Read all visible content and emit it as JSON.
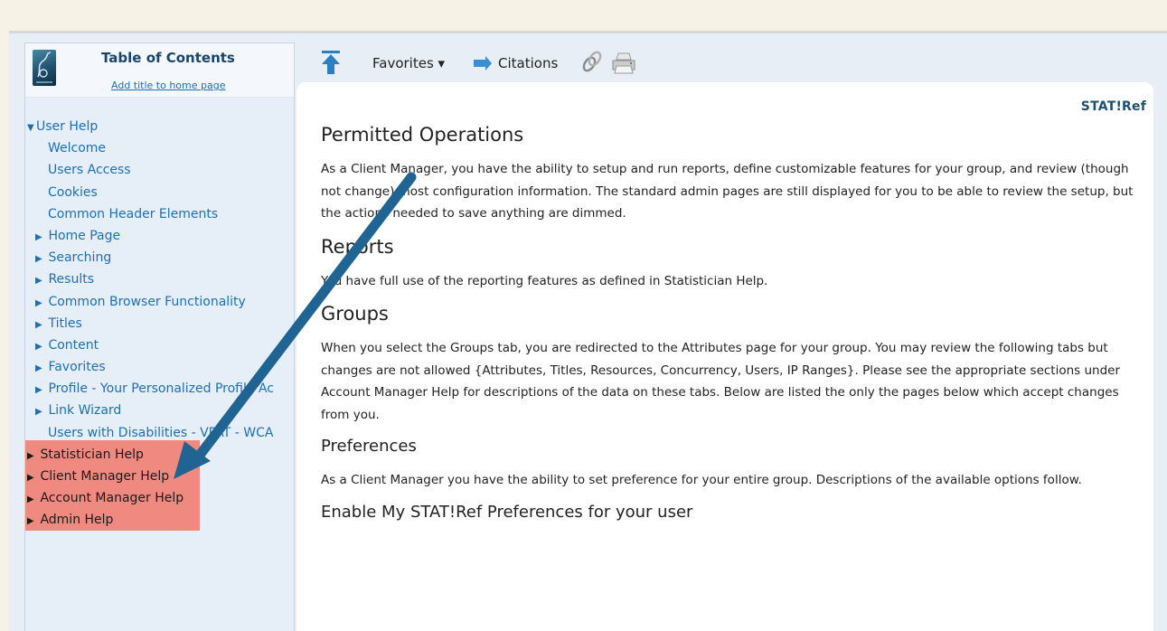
{
  "sidebar": {
    "title": "Table of Contents",
    "add_link": "Add title to home page",
    "items": [
      {
        "label": "User Help",
        "tri": "▼"
      },
      {
        "label": "Welcome",
        "tri": ""
      },
      {
        "label": "Users Access",
        "tri": ""
      },
      {
        "label": "Cookies",
        "tri": ""
      },
      {
        "label": "Common Header Elements",
        "tri": ""
      },
      {
        "label": "Home Page",
        "tri": "▶"
      },
      {
        "label": "Searching",
        "tri": "▶"
      },
      {
        "label": "Results",
        "tri": "▶"
      },
      {
        "label": "Common Browser Functionality",
        "tri": "▶"
      },
      {
        "label": "Titles",
        "tri": "▶"
      },
      {
        "label": "Content",
        "tri": "▶"
      },
      {
        "label": "Favorites",
        "tri": "▶"
      },
      {
        "label": "Profile - Your Personalized Profile Ac",
        "tri": "▶"
      },
      {
        "label": "Link Wizard",
        "tri": "▶"
      },
      {
        "label": "Users with Disabilities - VPAT - WCA",
        "tri": ""
      },
      {
        "label": "Statistician Help",
        "tri": "▶"
      },
      {
        "label": "Client Manager Help",
        "tri": "▶"
      },
      {
        "label": "Account Manager Help",
        "tri": "▶"
      },
      {
        "label": "Admin Help",
        "tri": "▶"
      }
    ]
  },
  "toolbar": {
    "favorites_label": "Favorites ▾",
    "citations_label": "Citations"
  },
  "brand": "STAT!Ref",
  "content": {
    "h_permitted": "Permitted Operations",
    "p_permitted": "As a Client Manager, you have the ability to setup and run reports, define customizable features for your group, and review (though not change) most configuration information. The standard admin pages are still displayed for you to be able to review the setup, but the actions needed to save anything are dimmed.",
    "h_reports": "Reports",
    "p_reports": "You have full use of the reporting features as defined in Statistician Help.",
    "h_groups": "Groups",
    "p_groups": "When you select the Groups tab, you are redirected to the Attributes page for your group. You may review the following tabs but changes are not allowed {Attributes, Titles, Resources, Concurrency, Users, IP Ranges}. Please see the appropriate sections under Account Manager Help for descriptions of the data on these tabs. Below are listed the only the pages below which accept changes from you.",
    "h_prefs": "Preferences",
    "p_prefs": "As a Client Manager you have the ability to set preference for your entire group. Descriptions of the available options follow.",
    "h_enable": "Enable My STAT!Ref Preferences for your user"
  },
  "colors": {
    "highlight": "#f08a80",
    "arrow": "#1f6492",
    "link": "#1d6fb7",
    "brand": "#1d4f74"
  }
}
